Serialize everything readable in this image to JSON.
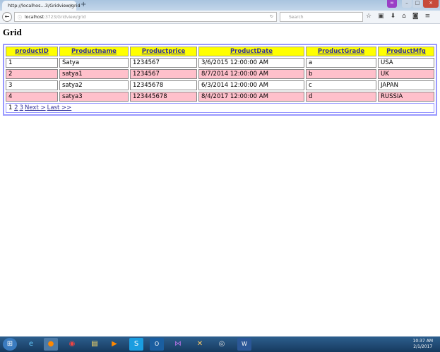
{
  "browser": {
    "tab_title": "http://localhos...3/Gridview/grid",
    "url_host": "localhost",
    "url_rest": ":3723/Gridview/grid",
    "search_placeholder": "Search"
  },
  "page": {
    "title": "Grid"
  },
  "grid": {
    "columns": [
      "productID",
      "Productname",
      "Productprice",
      "ProductDate",
      "ProductGrade",
      "ProductMfg"
    ],
    "rows": [
      [
        "1",
        "Satya",
        "1234567",
        "3/6/2015 12:00:00 AM",
        "a",
        "USA"
      ],
      [
        "2",
        "satya1",
        "1234567",
        "8/7/2014 12:00:00 AM",
        "b",
        "UK"
      ],
      [
        "3",
        "satya2",
        "12345678",
        "6/3/2014 12:00:00 AM",
        "c",
        "JAPAN"
      ],
      [
        "4",
        "satya3",
        "123445678",
        "8/4/2017 12:00:00 AM",
        "d",
        "RUSSIA"
      ]
    ],
    "pager": {
      "current": "1",
      "pages": [
        "2",
        "3"
      ],
      "next": "Next >",
      "last": "Last >>"
    },
    "header_color": "#ffff00",
    "alt_row_color": "#ffc0cb"
  },
  "taskbar": {
    "time": "10:37 AM",
    "date": "2/1/2017"
  }
}
